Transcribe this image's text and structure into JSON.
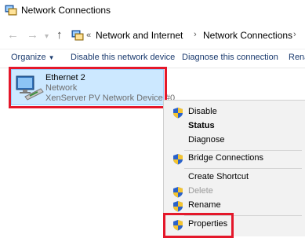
{
  "window": {
    "title": "Network Connections",
    "icon": "network-connections-icon"
  },
  "address": {
    "overflow": "«",
    "crumbs": [
      "Network and Internet",
      "Network Connections"
    ],
    "separator": "›"
  },
  "toolbar": {
    "organize_label": "Organize",
    "disable_label": "Disable this network device",
    "diagnose_label": "Diagnose this connection",
    "rename_label": "Rena"
  },
  "adapter": {
    "name": "Ethernet 2",
    "status": "Network",
    "device": "XenServer PV Network Device #0"
  },
  "menu": {
    "items": [
      {
        "label": "Disable",
        "icon": "shield-icon"
      },
      {
        "label": "Status",
        "icon": ""
      },
      {
        "label": "Diagnose",
        "icon": ""
      },
      {
        "label": "Bridge Connections",
        "icon": "shield-icon"
      },
      {
        "label": "Create Shortcut",
        "icon": ""
      },
      {
        "label": "Delete",
        "icon": "shield-icon"
      },
      {
        "label": "Rename",
        "icon": "shield-icon"
      },
      {
        "label": "Properties",
        "icon": "shield-icon"
      }
    ]
  },
  "colors": {
    "selection": "#cce8ff",
    "highlight_box": "#e4172a",
    "menu_bg": "#f2f2f2"
  }
}
